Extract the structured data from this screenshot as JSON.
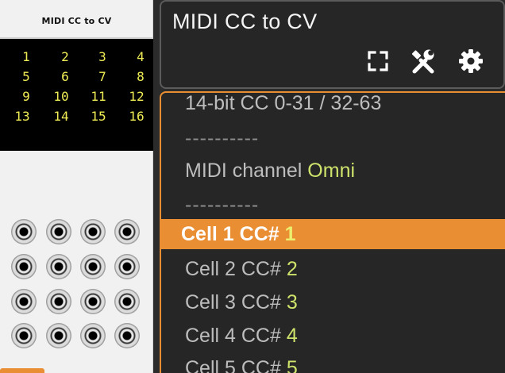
{
  "module": {
    "title": "MIDI CC to CV",
    "cell_labels": [
      "1",
      "2",
      "3",
      "4",
      "5",
      "6",
      "7",
      "8",
      "9",
      "10",
      "11",
      "12",
      "13",
      "14",
      "15",
      "16"
    ]
  },
  "menu": {
    "title": "MIDI CC to CV",
    "icons": [
      "fullscreen-icon",
      "tools-icon",
      "gear-icon"
    ],
    "items": [
      {
        "label": "14-bit CC 0-31 / 32-63",
        "value": ""
      },
      {
        "label": "----------",
        "value": ""
      },
      {
        "label": "MIDI channel",
        "value": "Omni"
      },
      {
        "label": "----------",
        "value": ""
      },
      {
        "label": "Cell 1 CC#",
        "value": "1"
      },
      {
        "label": "Cell 2 CC#",
        "value": "2"
      },
      {
        "label": "Cell 3 CC#",
        "value": "3"
      },
      {
        "label": "Cell 4 CC#",
        "value": "4"
      },
      {
        "label": "Cell 5 CC#",
        "value": "5"
      }
    ]
  },
  "colors": {
    "accent": "#e98e33",
    "value": "#cde36b",
    "screen_text": "#f0ec55"
  }
}
